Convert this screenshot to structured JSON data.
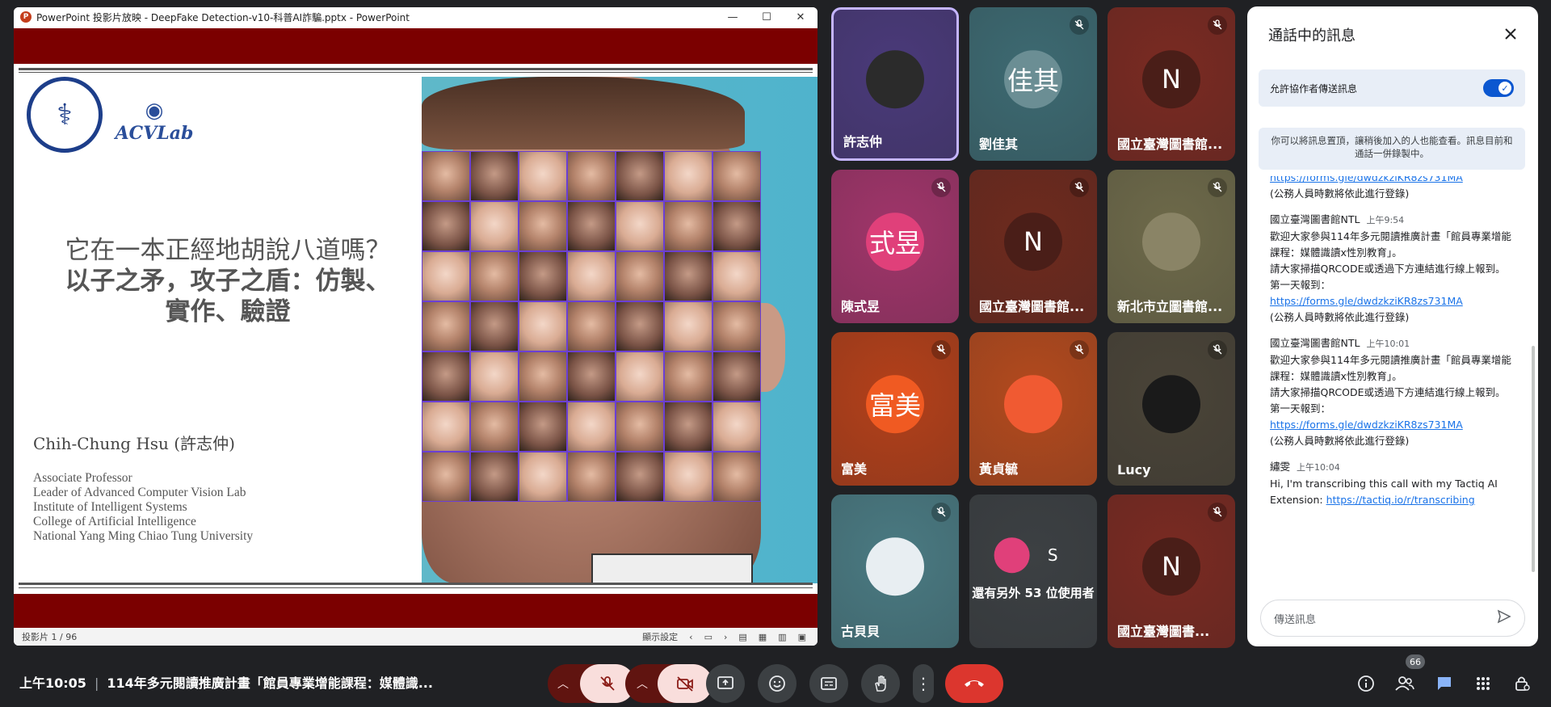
{
  "ppt": {
    "window_title": "PowerPoint 投影片放映 - DeepFake Detection-v10-科普AI詐騙.pptx - PowerPoint",
    "minimize": "—",
    "maximize": "☐",
    "close": "✕",
    "status_slide": "投影片 1 / 96",
    "status_display": "顯示設定"
  },
  "slide": {
    "title_line1": "它在一本正經地胡說八道嗎？",
    "title_line2": "以子之矛，攻子之盾：仿製、",
    "title_line3": "實作、驗證",
    "author": "Chih-Chung Hsu (許志仲)",
    "affiliation": [
      "Associate Professor",
      "Leader of Advanced Computer Vision Lab",
      "Institute of Intelligent Systems",
      "College of Artificial Intelligence",
      "National Yang Ming Chiao Tung University"
    ],
    "logo_text": "ACVLab"
  },
  "tiles": [
    {
      "name": "許志仲",
      "avatar": "",
      "color": "#4a3a7a",
      "avatar_color": "#2b2b2b",
      "muted": false
    },
    {
      "name": "劉佳其",
      "avatar": "佳其",
      "color": "#3d6a72",
      "avatar_color": "#6b8e94",
      "muted": true
    },
    {
      "name": "國立臺灣圖書館...",
      "avatar": "N",
      "color": "#7a2a22",
      "avatar_color": "#4a1e18",
      "muted": true
    },
    {
      "name": "陳式昱",
      "avatar": "式昱",
      "color": "#a0356a",
      "avatar_color": "#e0407a",
      "muted": true
    },
    {
      "name": "國立臺灣圖書館...",
      "avatar": "N",
      "color": "#6e2a1e",
      "avatar_color": "#4a1e18",
      "muted": true
    },
    {
      "name": "新北市立圖書館...",
      "avatar": "",
      "color": "#6e6a4a",
      "avatar_color": "#8a8466",
      "muted": true
    },
    {
      "name": "富美",
      "avatar": "富美",
      "color": "#b3401a",
      "avatar_color": "#f05a22",
      "muted": true
    },
    {
      "name": "黃貞毓",
      "avatar": "",
      "color": "#b34a1e",
      "avatar_color": "#f05a32",
      "muted": true
    },
    {
      "name": "Lucy",
      "avatar": "",
      "color": "#4a4438",
      "avatar_color": "#1a1a1a",
      "muted": true
    },
    {
      "name": "古貝貝",
      "avatar": "",
      "color": "#4a7a82",
      "avatar_color": "#e8eef2",
      "muted": true
    },
    {
      "name": "還有另外 53 位使用者",
      "avatar": "S",
      "color": "#3c4043",
      "avatar_color": "#e0407a",
      "muted": false
    },
    {
      "name": "國立臺灣圖書...",
      "avatar": "N",
      "color": "#7a2a22",
      "avatar_color": "#4a1e18",
      "muted": true
    }
  ],
  "chat": {
    "header": "通話中的訊息",
    "allow_label": "允許協作者傳送訊息",
    "pin_note": "你可以將訊息置頂，讓稍後加入的人也能查看。訊息目前和通話一併錄製中。",
    "top_partial_link": "https://forms.gle/dwdzkziKR8zs731MA",
    "top_partial_note": "(公務人員時數將依此進行登錄)",
    "messages": [
      {
        "sender": "國立臺灣圖書館NTL",
        "time": "上午9:54",
        "body": "歡迎大家參與114年多元閱讀推廣計畫「館員專業增能課程：媒體識讀x性別教育」。\n請大家掃描QRCODE或透過下方連結進行線上報到。\n第一天報到：",
        "link": "https://forms.gle/dwdzkziKR8zs731MA",
        "note": "(公務人員時數將依此進行登錄)"
      },
      {
        "sender": "國立臺灣圖書館NTL",
        "time": "上午10:01",
        "body": "歡迎大家參與114年多元閱讀推廣計畫「館員專業增能課程：媒體識讀x性別教育」。\n請大家掃描QRCODE或透過下方連結進行線上報到。\n第一天報到：",
        "link": "https://forms.gle/dwdzkziKR8zs731MA",
        "note": "(公務人員時數將依此進行登錄)"
      },
      {
        "sender": "繡雯",
        "time": "上午10:04",
        "body": "Hi, I'm transcribing this call with my Tactiq AI Extension: ",
        "link": "https://tactiq.io/r/transcribing",
        "note": ""
      }
    ],
    "input_placeholder": "傳送訊息"
  },
  "bottom": {
    "time": "上午10:05",
    "meeting_title": "114年多元閱讀推廣計畫「館員專業增能課程：媒體識...",
    "people_count": "66"
  },
  "colors": {
    "background": "#202124",
    "leave": "#dc362e",
    "muted_bg": "#f9dedc",
    "accent": "#0b57d0"
  }
}
